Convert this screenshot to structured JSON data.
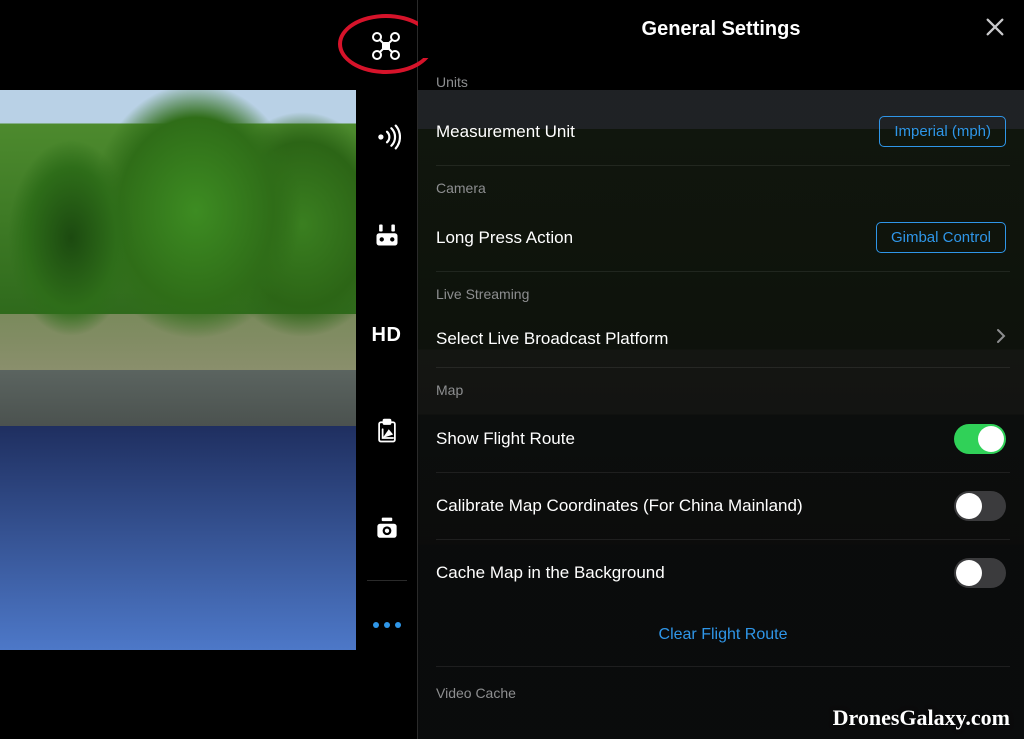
{
  "header": {
    "title": "General Settings"
  },
  "sections": {
    "units": {
      "label": "Units",
      "measurement": {
        "label": "Measurement Unit",
        "value": "Imperial (mph)"
      }
    },
    "camera": {
      "label": "Camera",
      "longPress": {
        "label": "Long Press Action",
        "value": "Gimbal Control"
      }
    },
    "liveStreaming": {
      "label": "Live Streaming",
      "selectPlatform": {
        "label": "Select Live Broadcast Platform"
      }
    },
    "map": {
      "label": "Map",
      "showFlightRoute": {
        "label": "Show Flight Route",
        "on": true
      },
      "calibrate": {
        "label": "Calibrate Map Coordinates (For China Mainland)",
        "on": false
      },
      "cacheBackground": {
        "label": "Cache Map in the Background",
        "on": false
      },
      "clearRoute": {
        "label": "Clear Flight Route"
      }
    },
    "videoCache": {
      "label": "Video Cache"
    }
  },
  "sidebarIcons": {
    "drone": "drone-icon",
    "signal": "signal-icon",
    "remote": "remote-controller-icon",
    "hd": "HD",
    "battery": "battery-icon",
    "gimbal": "gimbal-icon",
    "more": "more-icon"
  },
  "watermark": "DronesGalaxy.com",
  "colors": {
    "accent": "#2f96e8",
    "toggleOn": "#30d158",
    "annotation": "#d6132a"
  }
}
